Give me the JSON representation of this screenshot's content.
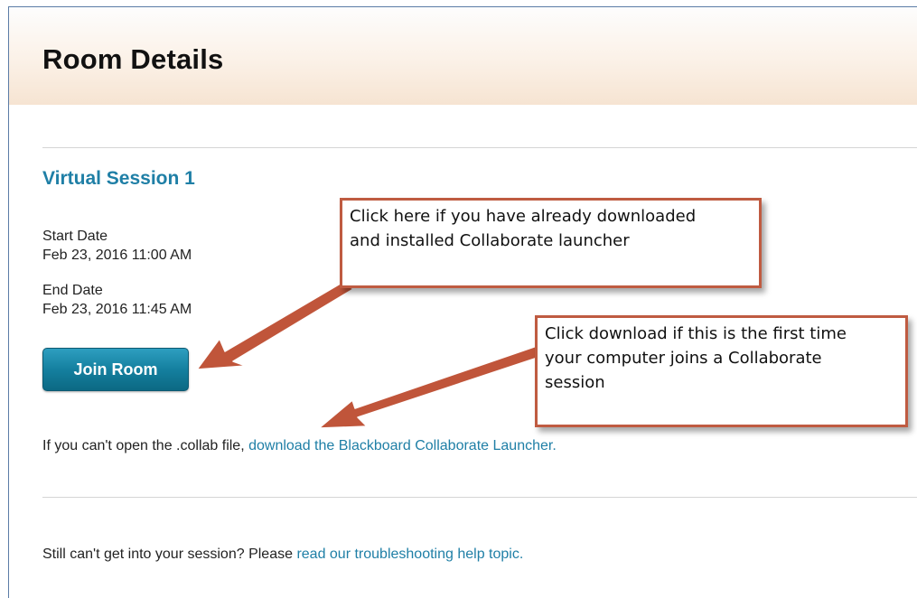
{
  "page": {
    "title": "Room Details"
  },
  "session": {
    "title": "Virtual Session 1",
    "start_label": "Start Date",
    "start_value": "Feb 23, 2016 11:00 AM",
    "end_label": "End Date",
    "end_value": "Feb 23, 2016 11:45 AM",
    "join_label": "Join Room"
  },
  "download": {
    "prefix": "If you can't open the .collab file, ",
    "link": "download the Blackboard Collaborate Launcher."
  },
  "help": {
    "prefix": "Still can't get into your session? Please ",
    "link": "read our troubleshooting help topic."
  },
  "callouts": {
    "join_line1": "Click here if you have already downloaded",
    "join_line2": "and installed Collaborate launcher",
    "download_line1": "Click download if this is the first time",
    "download_line2": "your computer joins a Collaborate",
    "download_line3": "session"
  },
  "colors": {
    "accent": "#1f7fa6",
    "button": "#14809f",
    "callout_border": "#bf5b41",
    "arrow": "#c0553a"
  }
}
